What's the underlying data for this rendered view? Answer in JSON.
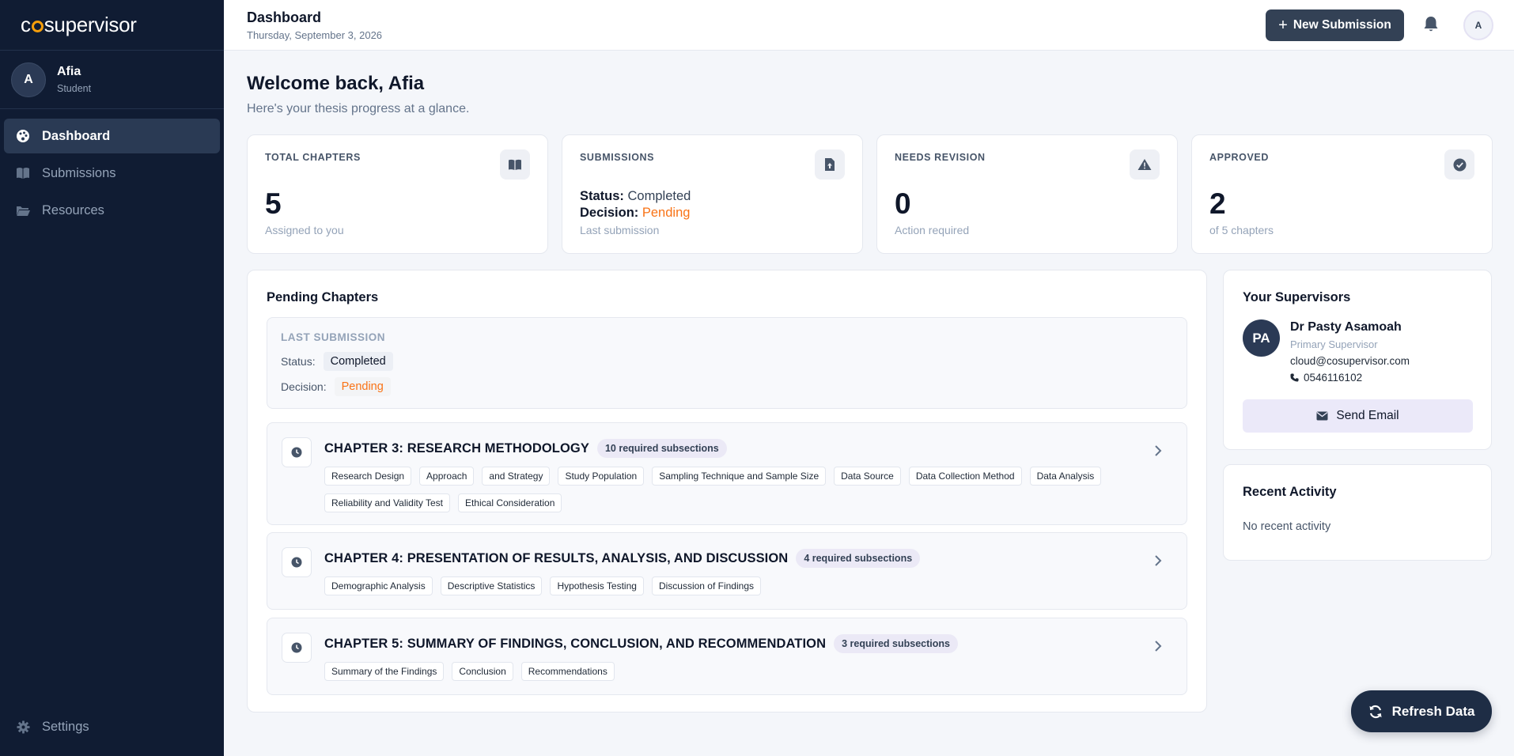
{
  "app": {
    "logo_pre": "c",
    "logo_post": "supervisor"
  },
  "user": {
    "initial": "A",
    "name": "Afia",
    "role": "Student"
  },
  "sidebar": {
    "items": [
      {
        "label": "Dashboard",
        "icon": "palette-icon",
        "active": true
      },
      {
        "label": "Submissions",
        "icon": "book-icon",
        "active": false
      },
      {
        "label": "Resources",
        "icon": "folder-icon",
        "active": false
      }
    ],
    "settings_label": "Settings"
  },
  "topbar": {
    "title": "Dashboard",
    "date": "Thursday, September 3, 2026",
    "new_submission_label": "New Submission",
    "avatar_initial": "A"
  },
  "welcome": {
    "title": "Welcome back, Afia",
    "subtitle": "Here's your thesis progress at a glance."
  },
  "stats": {
    "total": {
      "label": "TOTAL CHAPTERS",
      "value": "5",
      "caption": "Assigned to you"
    },
    "submissions": {
      "label": "SUBMISSIONS",
      "status_key": "Status:",
      "status_value": "Completed",
      "decision_key": "Decision:",
      "decision_value": "Pending",
      "caption": "Last submission"
    },
    "revision": {
      "label": "NEEDS REVISION",
      "value": "0",
      "caption": "Action required"
    },
    "approved": {
      "label": "APPROVED",
      "value": "2",
      "caption": "of 5 chapters"
    }
  },
  "pending": {
    "title": "Pending Chapters",
    "last_submission": {
      "label": "LAST SUBMISSION",
      "status_key": "Status:",
      "status_value": "Completed",
      "decision_key": "Decision:",
      "decision_value": "Pending"
    },
    "chapters": [
      {
        "title": "CHAPTER 3: RESEARCH METHODOLOGY",
        "badge": "10 required subsections",
        "tags": [
          "Research Design",
          "Approach",
          "and Strategy",
          "Study Population",
          "Sampling Technique and Sample Size",
          "Data Source",
          "Data Collection Method",
          "Data Analysis",
          "Reliability and Validity Test",
          "Ethical Consideration"
        ]
      },
      {
        "title": "CHAPTER 4: PRESENTATION OF RESULTS, ANALYSIS, AND DISCUSSION",
        "badge": "4 required subsections",
        "tags": [
          "Demographic Analysis",
          "Descriptive Statistics",
          "Hypothesis Testing",
          "Discussion of Findings"
        ]
      },
      {
        "title": "CHAPTER 5: SUMMARY OF FINDINGS, CONCLUSION, AND RECOMMENDATION",
        "badge": "3 required subsections",
        "tags": [
          "Summary of the Findings",
          "Conclusion",
          "Recommendations"
        ]
      }
    ]
  },
  "supervisors": {
    "title": "Your Supervisors",
    "initials": "PA",
    "name": "Dr Pasty Asamoah",
    "role": "Primary Supervisor",
    "email": "cloud@cosupervisor.com",
    "phone": "0546116102",
    "send_email_label": "Send Email"
  },
  "activity": {
    "title": "Recent Activity",
    "empty": "No recent activity"
  },
  "refresh_label": "Refresh Data",
  "colors": {
    "sidebar": "#101c33",
    "accent_orange": "#f97316",
    "primary_button": "#334155",
    "badge": "#ebe9f6"
  }
}
